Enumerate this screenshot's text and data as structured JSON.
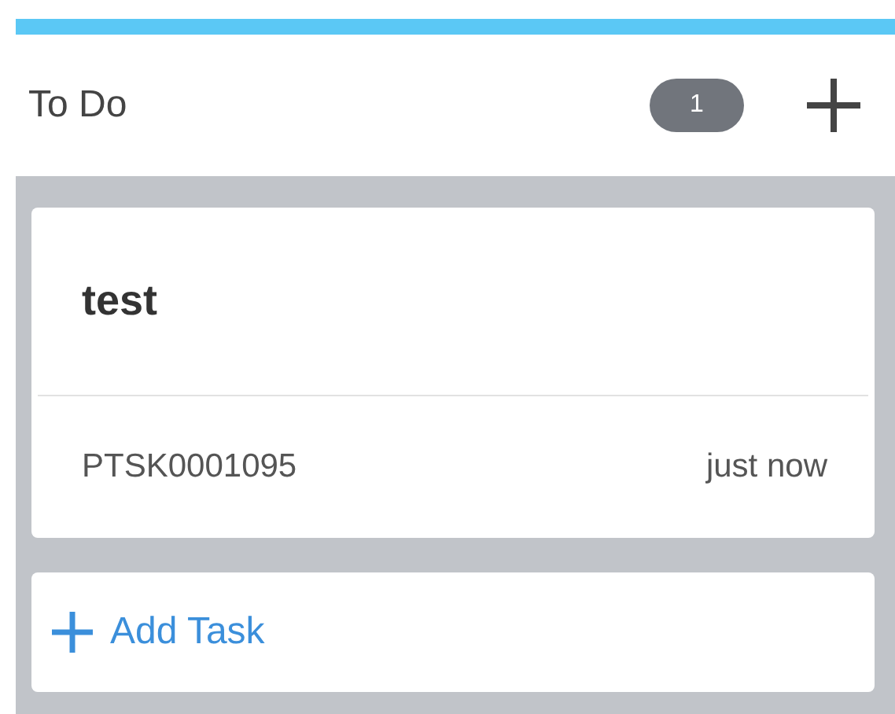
{
  "column": {
    "title": "To Do",
    "count": "1"
  },
  "cards": [
    {
      "title": "test",
      "number": "PTSK0001095",
      "updated": "just now"
    }
  ],
  "add_task": {
    "label": "Add Task"
  }
}
